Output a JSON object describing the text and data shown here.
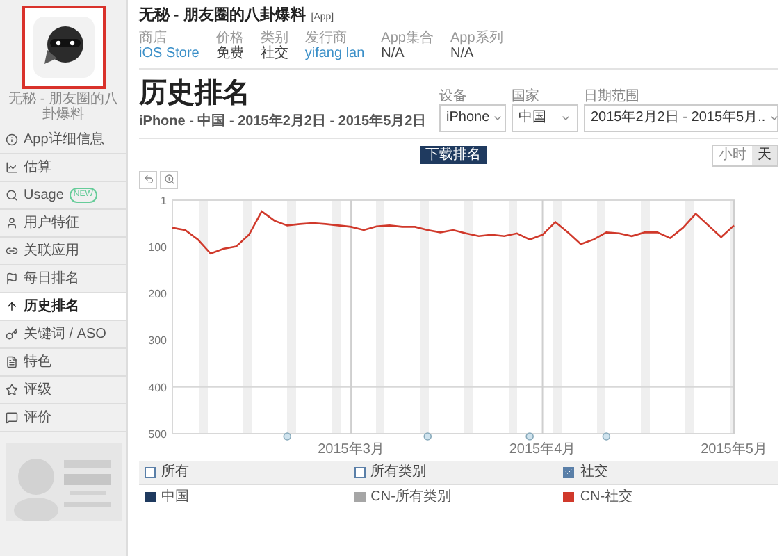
{
  "sidebar": {
    "app_caption": "无秘 - 朋友圈的八卦爆料",
    "items": [
      {
        "label": "App详细信息",
        "selected": false
      },
      {
        "label": "估算",
        "selected": false
      },
      {
        "label": "Usage",
        "badge": "NEW",
        "selected": false
      },
      {
        "label": "用户特征",
        "selected": false
      },
      {
        "label": "关联应用",
        "selected": false
      },
      {
        "label": "每日排名",
        "selected": false
      },
      {
        "label": "历史排名",
        "selected": true
      },
      {
        "label": "关键词 / ASO",
        "selected": false
      },
      {
        "label": "特色",
        "selected": false
      },
      {
        "label": "评级",
        "selected": false
      },
      {
        "label": "评价",
        "selected": false
      }
    ]
  },
  "app": {
    "title": "无秘 - 朋友圈的八卦爆料",
    "tag": "[App]",
    "meta": [
      {
        "label": "商店",
        "value": "iOS Store",
        "link": true
      },
      {
        "label": "价格",
        "value": "免费",
        "link": false
      },
      {
        "label": "类别",
        "value": "社交",
        "link": false
      },
      {
        "label": "发行商",
        "value": "yifang lan",
        "link": true
      },
      {
        "label": "App集合",
        "value": "N/A",
        "link": false
      },
      {
        "label": "App系列",
        "value": "N/A",
        "link": false
      }
    ]
  },
  "page": {
    "title": "历史排名",
    "subtitle": "iPhone - 中国 - 2015年2月2日 - 2015年5月2日"
  },
  "filters": [
    {
      "label": "设备",
      "value": "iPhone"
    },
    {
      "label": "国家",
      "value": "中国"
    },
    {
      "label": "日期范围",
      "value": "2015年2月2日 - 2015年5月.."
    }
  ],
  "download_button": "下载排名",
  "granularity": [
    {
      "label": "小时",
      "selected": false
    },
    {
      "label": "天",
      "selected": true
    }
  ],
  "chart": {
    "chart_data": {
      "type": "line",
      "categories": [
        null,
        null,
        null,
        null,
        null,
        null,
        null,
        null,
        null,
        null,
        null,
        null,
        null,
        null,
        "2015年3月",
        null,
        null,
        null,
        null,
        null,
        null,
        null,
        null,
        null,
        null,
        null,
        null,
        null,
        null,
        "2015年4月",
        null,
        null,
        null,
        null,
        null,
        null,
        null,
        null,
        null,
        null,
        null,
        null,
        null,
        null,
        "2015年5月"
      ],
      "series": [
        {
          "color": "#d0392b",
          "values": [
            60,
            65,
            85,
            115,
            105,
            100,
            75,
            25,
            45,
            55,
            52,
            50,
            52,
            55,
            58,
            65,
            57,
            55,
            58,
            58,
            65,
            70,
            65,
            72,
            78,
            75,
            78,
            72,
            85,
            75,
            48,
            70,
            95,
            85,
            70,
            72,
            78,
            70,
            70,
            82,
            60,
            30,
            55,
            80,
            55
          ]
        }
      ],
      "ylim": [
        500,
        1
      ],
      "grid": true,
      "ref_lines": [
        {
          "axis": "y",
          "value": 400
        }
      ],
      "yticks": [
        1,
        100,
        200,
        300,
        400,
        500
      ]
    }
  },
  "legend": {
    "headers": [
      {
        "label": "所有",
        "checked": false
      },
      {
        "label": "所有类别",
        "checked": false
      },
      {
        "label": "社交",
        "checked": true
      }
    ],
    "rows": [
      {
        "label": "中国",
        "color": "#1f3a5f"
      },
      {
        "label": "CN-所有类别",
        "color": "#a6a6a6"
      },
      {
        "label": "CN-社交",
        "color": "#d0392b"
      }
    ]
  }
}
